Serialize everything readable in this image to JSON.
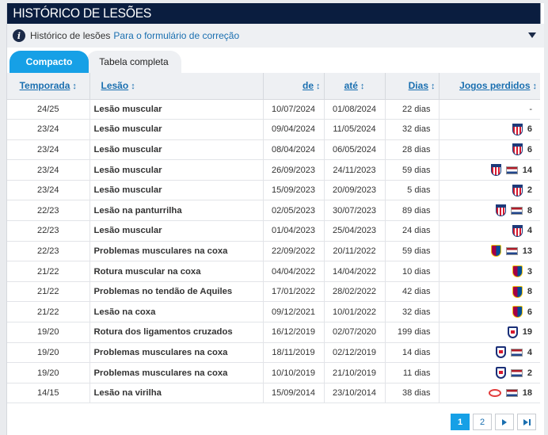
{
  "panel": {
    "title": "HISTÓRICO DE LESÕES",
    "info_text": "Histórico de lesões",
    "info_link": "Para o formulário de correção"
  },
  "tabs": [
    {
      "label": "Compacto",
      "active": true
    },
    {
      "label": "Tabela completa",
      "active": false
    }
  ],
  "table": {
    "headers": {
      "season": "Temporada",
      "injury": "Lesão",
      "from": "de",
      "until": "até",
      "days": "Dias",
      "games": "Jogos perdidos",
      "sort_glyph": "↕"
    },
    "rows": [
      {
        "season": "24/25",
        "injury": "Lesão muscular",
        "from": "10/07/2024",
        "until": "01/08/2024",
        "days": "22 dias",
        "clubs": [],
        "flag": false,
        "games": "-"
      },
      {
        "season": "23/24",
        "injury": "Lesão muscular",
        "from": "09/04/2024",
        "until": "11/05/2024",
        "days": "32 dias",
        "clubs": [
          "atletico-madrid-crest"
        ],
        "flag": false,
        "games": "6"
      },
      {
        "season": "23/24",
        "injury": "Lesão muscular",
        "from": "08/04/2024",
        "until": "06/05/2024",
        "days": "28 dias",
        "clubs": [
          "atletico-madrid-crest"
        ],
        "flag": false,
        "games": "6"
      },
      {
        "season": "23/24",
        "injury": "Lesão muscular",
        "from": "26/09/2023",
        "until": "24/11/2023",
        "days": "59 dias",
        "clubs": [
          "atletico-madrid-crest"
        ],
        "flag": true,
        "games": "14"
      },
      {
        "season": "23/24",
        "injury": "Lesão muscular",
        "from": "15/09/2023",
        "until": "20/09/2023",
        "days": "5 dias",
        "clubs": [
          "atletico-madrid-crest"
        ],
        "flag": false,
        "games": "2"
      },
      {
        "season": "22/23",
        "injury": "Lesão na panturrilha",
        "from": "02/05/2023",
        "until": "30/07/2023",
        "days": "89 dias",
        "clubs": [
          "atletico-madrid-crest"
        ],
        "flag": true,
        "games": "8"
      },
      {
        "season": "22/23",
        "injury": "Lesão muscular",
        "from": "01/04/2023",
        "until": "25/04/2023",
        "days": "24 dias",
        "clubs": [
          "atletico-madrid-crest"
        ],
        "flag": false,
        "games": "4"
      },
      {
        "season": "22/23",
        "injury": "Problemas musculares na coxa",
        "from": "22/09/2022",
        "until": "20/11/2022",
        "days": "59 dias",
        "clubs": [
          "barcelona-crest"
        ],
        "flag": true,
        "games": "13"
      },
      {
        "season": "21/22",
        "injury": "Rotura muscular na coxa",
        "from": "04/04/2022",
        "until": "14/04/2022",
        "days": "10 dias",
        "clubs": [
          "barcelona-crest"
        ],
        "flag": false,
        "games": "3"
      },
      {
        "season": "21/22",
        "injury": "Problemas no tendão de Aquiles",
        "from": "17/01/2022",
        "until": "28/02/2022",
        "days": "42 dias",
        "clubs": [
          "barcelona-crest"
        ],
        "flag": false,
        "games": "8"
      },
      {
        "season": "21/22",
        "injury": "Lesão na coxa",
        "from": "09/12/2021",
        "until": "10/01/2022",
        "days": "32 dias",
        "clubs": [
          "barcelona-crest"
        ],
        "flag": false,
        "games": "6"
      },
      {
        "season": "19/20",
        "injury": "Rotura dos ligamentos cruzados",
        "from": "16/12/2019",
        "until": "02/07/2020",
        "days": "199 dias",
        "clubs": [
          "lyon-crest"
        ],
        "flag": false,
        "games": "19"
      },
      {
        "season": "19/20",
        "injury": "Problemas musculares na coxa",
        "from": "18/11/2019",
        "until": "02/12/2019",
        "days": "14 dias",
        "clubs": [
          "lyon-crest"
        ],
        "flag": true,
        "games": "4"
      },
      {
        "season": "19/20",
        "injury": "Problemas musculares na coxa",
        "from": "10/10/2019",
        "until": "21/10/2019",
        "days": "11 dias",
        "clubs": [
          "lyon-crest"
        ],
        "flag": true,
        "games": "2"
      },
      {
        "season": "14/15",
        "injury": "Lesão na virilha",
        "from": "15/09/2014",
        "until": "23/10/2014",
        "days": "38 dias",
        "clubs": [
          "psv-crest"
        ],
        "flag": true,
        "games": "18"
      }
    ]
  },
  "pagination": {
    "pages": [
      "1",
      "2"
    ],
    "current": "1",
    "next_icon": "next-page-icon",
    "last_icon": "last-page-icon"
  }
}
